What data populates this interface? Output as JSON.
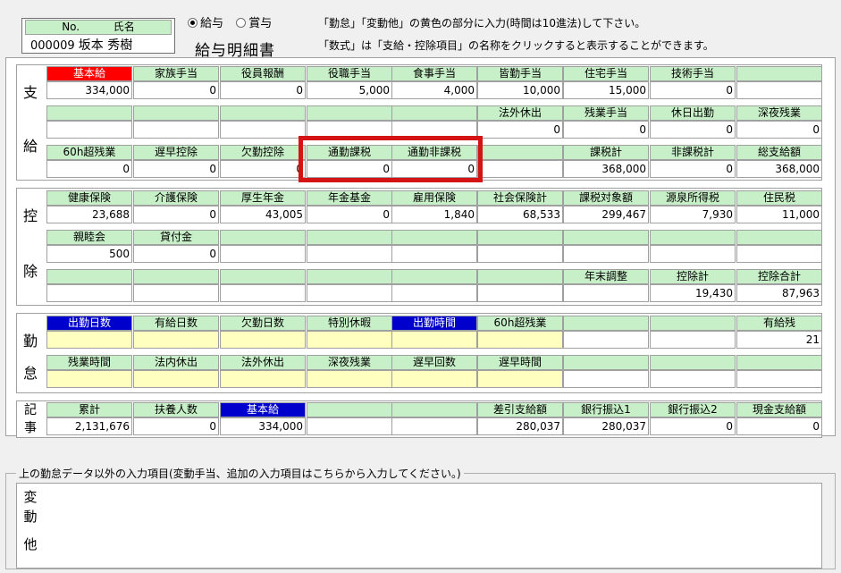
{
  "employee": {
    "no_label": "No.",
    "name_label": "氏名",
    "no": "000009",
    "name": "坂本 秀樹"
  },
  "mode": {
    "salary_label": "給与",
    "bonus_label": "賞与",
    "selected": "salary"
  },
  "title": "給与明細書",
  "notes": [
    "「勤怠」「変動他」の黄色の部分に入力(時間は10進法)して下さい。",
    "「数式」は「支給・控除項目」の名称をクリックすると表示することができます。"
  ],
  "sections": {
    "shikyu": {
      "label_top": "支",
      "label_bottom": "給"
    },
    "kojo": {
      "label_top": "控",
      "label_bottom": "除"
    },
    "kintai": {
      "label_top": "勤",
      "label_bottom": "怠"
    },
    "kiji": {
      "label_top": "記",
      "label_bottom": "事"
    },
    "hendo": {
      "label_top": "変",
      "label_mid": "動",
      "label_bottom": "他"
    }
  },
  "shikyu_rows": [
    [
      {
        "h": "基本給",
        "v": "334,000",
        "hc": "red"
      },
      {
        "h": "家族手当",
        "v": "0"
      },
      {
        "h": "役員報酬",
        "v": "0"
      },
      {
        "h": "役職手当",
        "v": "5,000"
      },
      {
        "h": "食事手当",
        "v": "4,000"
      },
      {
        "h": "皆勤手当",
        "v": "10,000"
      },
      {
        "h": "住宅手当",
        "v": "15,000"
      },
      {
        "h": "技術手当",
        "v": "0"
      },
      {
        "h": "",
        "v": ""
      }
    ],
    [
      {
        "h": "",
        "v": ""
      },
      {
        "h": "",
        "v": ""
      },
      {
        "h": "",
        "v": ""
      },
      {
        "h": "",
        "v": ""
      },
      {
        "h": "",
        "v": ""
      },
      {
        "h": "法外休出",
        "v": "0"
      },
      {
        "h": "残業手当",
        "v": "0"
      },
      {
        "h": "休日出勤",
        "v": "0"
      },
      {
        "h": "深夜残業",
        "v": "0"
      }
    ],
    [
      {
        "h": "60h超残業",
        "v": "0"
      },
      {
        "h": "遅早控除",
        "v": "0"
      },
      {
        "h": "欠勤控除",
        "v": "0"
      },
      {
        "h": "通勤課税",
        "v": "0"
      },
      {
        "h": "通勤非課税",
        "v": "0"
      },
      {
        "h": "",
        "v": ""
      },
      {
        "h": "課税計",
        "v": "368,000"
      },
      {
        "h": "非課税計",
        "v": "0"
      },
      {
        "h": "総支給額",
        "v": "368,000"
      }
    ]
  ],
  "kojo_rows": [
    [
      {
        "h": "健康保険",
        "v": "23,688"
      },
      {
        "h": "介護保険",
        "v": "0"
      },
      {
        "h": "厚生年金",
        "v": "43,005"
      },
      {
        "h": "年金基金",
        "v": "0"
      },
      {
        "h": "雇用保険",
        "v": "1,840"
      },
      {
        "h": "社会保険計",
        "v": "68,533"
      },
      {
        "h": "課税対象額",
        "v": "299,467"
      },
      {
        "h": "源泉所得税",
        "v": "7,930"
      },
      {
        "h": "住民税",
        "v": "11,000"
      }
    ],
    [
      {
        "h": "親睦会",
        "v": "500"
      },
      {
        "h": "貸付金",
        "v": "0"
      },
      {
        "h": "",
        "v": ""
      },
      {
        "h": "",
        "v": ""
      },
      {
        "h": "",
        "v": ""
      },
      {
        "h": "",
        "v": ""
      },
      {
        "h": "",
        "v": ""
      },
      {
        "h": "",
        "v": ""
      },
      {
        "h": "",
        "v": ""
      }
    ],
    [
      {
        "h": "",
        "v": ""
      },
      {
        "h": "",
        "v": ""
      },
      {
        "h": "",
        "v": ""
      },
      {
        "h": "",
        "v": ""
      },
      {
        "h": "",
        "v": ""
      },
      {
        "h": "",
        "v": ""
      },
      {
        "h": "年末調整",
        "v": ""
      },
      {
        "h": "控除計",
        "v": "19,430"
      },
      {
        "h": "控除合計",
        "v": "87,963"
      }
    ]
  ],
  "kintai_rows": [
    [
      {
        "h": "出勤日数",
        "v": "",
        "hc": "blue",
        "vc": "yellow"
      },
      {
        "h": "有給日数",
        "v": "",
        "vc": "yellow"
      },
      {
        "h": "欠勤日数",
        "v": "",
        "vc": "yellow"
      },
      {
        "h": "特別休暇",
        "v": "",
        "vc": "yellow"
      },
      {
        "h": "出勤時間",
        "v": "",
        "hc": "blue",
        "vc": "yellow"
      },
      {
        "h": "60h超残業",
        "v": "",
        "vc": "yellow"
      },
      {
        "h": "",
        "v": ""
      },
      {
        "h": "",
        "v": ""
      },
      {
        "h": "有給残",
        "v": "21"
      }
    ],
    [
      {
        "h": "残業時間",
        "v": "",
        "vc": "yellow"
      },
      {
        "h": "法内休出",
        "v": "",
        "vc": "yellow"
      },
      {
        "h": "法外休出",
        "v": "",
        "vc": "yellow"
      },
      {
        "h": "深夜残業",
        "v": "",
        "vc": "yellow"
      },
      {
        "h": "遅早回数",
        "v": "",
        "vc": "yellow"
      },
      {
        "h": "遅早時間",
        "v": "",
        "vc": "yellow"
      },
      {
        "h": "",
        "v": ""
      },
      {
        "h": "",
        "v": ""
      },
      {
        "h": "",
        "v": ""
      }
    ]
  ],
  "kiji_row": [
    {
      "h": "累計",
      "v": "2,131,676"
    },
    {
      "h": "扶養人数",
      "v": "0"
    },
    {
      "h": "基本給",
      "v": "334,000",
      "hc": "blue"
    },
    {
      "h": "",
      "v": ""
    },
    {
      "h": "",
      "v": ""
    },
    {
      "h": "差引支給額",
      "v": "280,037"
    },
    {
      "h": "銀行振込1",
      "v": "280,037"
    },
    {
      "h": "銀行振込2",
      "v": "0"
    },
    {
      "h": "現金支給額",
      "v": "0"
    }
  ],
  "hendo": {
    "group_label": "上の勤怠データ以外の入力項目(変動手当、追加の入力項目はこちらから入力してください。)"
  }
}
